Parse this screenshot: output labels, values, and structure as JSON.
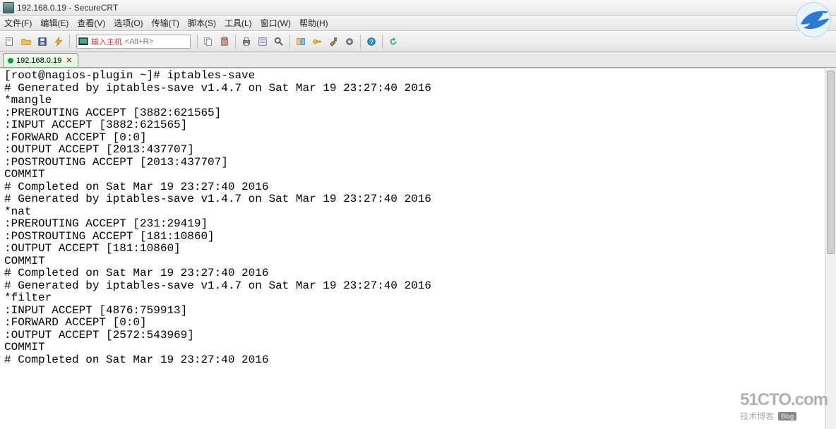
{
  "window": {
    "title": "192.168.0.19 - SecureCRT"
  },
  "menu": {
    "file": "文件(F)",
    "edit": "编辑(E)",
    "view": "查看(V)",
    "options": "选项(O)",
    "transfer": "传输(T)",
    "script": "脚本(S)",
    "tools": "工具(L)",
    "window": "窗口(W)",
    "help": "帮助(H)"
  },
  "toolbar": {
    "host_label": "输入主机",
    "host_placeholder": "<Alt+R>"
  },
  "tab": {
    "label": "192.168.0.19",
    "close": "✕"
  },
  "terminal": {
    "prompt": "[root@nagios-plugin ~]# ",
    "command": "iptables-save",
    "lines": [
      "# Generated by iptables-save v1.4.7 on Sat Mar 19 23:27:40 2016",
      "*mangle",
      ":PREROUTING ACCEPT [3882:621565]",
      ":INPUT ACCEPT [3882:621565]",
      ":FORWARD ACCEPT [0:0]",
      ":OUTPUT ACCEPT [2013:437707]",
      ":POSTROUTING ACCEPT [2013:437707]",
      "COMMIT",
      "# Completed on Sat Mar 19 23:27:40 2016",
      "# Generated by iptables-save v1.4.7 on Sat Mar 19 23:27:40 2016",
      "*nat",
      ":PREROUTING ACCEPT [231:29419]",
      ":POSTROUTING ACCEPT [181:10860]",
      ":OUTPUT ACCEPT [181:10860]",
      "COMMIT",
      "# Completed on Sat Mar 19 23:27:40 2016",
      "# Generated by iptables-save v1.4.7 on Sat Mar 19 23:27:40 2016",
      "*filter",
      ":INPUT ACCEPT [4876:759913]",
      ":FORWARD ACCEPT [0:0]",
      ":OUTPUT ACCEPT [2572:543969]",
      "COMMIT",
      "# Completed on Sat Mar 19 23:27:40 2016"
    ]
  },
  "watermark": {
    "line1": "51CTO.com",
    "line2": "技术博客",
    "badge": "Blog"
  },
  "icons": {
    "new": "new-session-icon",
    "open": "open-folder-icon",
    "save": "save-icon",
    "flash": "lightning-icon",
    "copy": "copy-icon",
    "paste": "paste-icon",
    "print": "print-icon",
    "props": "properties-icon",
    "find": "find-icon",
    "xfer": "transfer-icon",
    "key": "key-icon",
    "hammer": "tools-icon",
    "gear": "gear-icon",
    "help": "help-icon",
    "refresh": "refresh-icon"
  }
}
